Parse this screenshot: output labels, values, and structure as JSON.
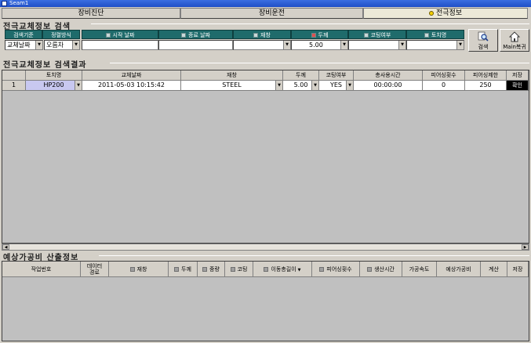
{
  "window": {
    "title": "Seam1"
  },
  "tabs": [
    {
      "label": "장비진단"
    },
    {
      "label": "장비운전"
    },
    {
      "label": "전극정보"
    }
  ],
  "search": {
    "title": "전극교체정보 검색",
    "headers": {
      "criteria": "검색기준",
      "sort": "정렬방식",
      "start_date": "시작 날짜",
      "end_date": "종료 날짜",
      "material": "재창",
      "thickness": "두께",
      "coating": "코팅여부",
      "tip_name": "토치명"
    },
    "values": {
      "criteria": "교체날짜",
      "sort": "오름차",
      "start_date": "",
      "end_date": "",
      "material": "",
      "thickness": "5.00",
      "coating": "",
      "tip_name": ""
    },
    "buttons": {
      "search": "검색",
      "main": "Main복귀"
    }
  },
  "results": {
    "title": "전극교체정보 검색결과",
    "columns": [
      "토치명",
      "교체날짜",
      "재창",
      "두께",
      "코팅여부",
      "총사용시간",
      "피어싱횟수",
      "피어싱제한",
      "저장"
    ],
    "rows": [
      {
        "num": "1",
        "tip": "HP200",
        "date": "2011-05-03 10:15:42",
        "material": "STEEL",
        "thickness": "5.00",
        "coating": "YES",
        "time": "00:00:00",
        "pierce_count": "0",
        "pierce_limit": "250",
        "save": "확인"
      }
    ]
  },
  "cost": {
    "title": "예상가공비 산출정보",
    "columns": {
      "job_no": "작업번호",
      "data_path_1": "데이터",
      "data_path_2": "경로",
      "material": "재창",
      "thickness": "두께",
      "weight": "중량",
      "coating": "코팅",
      "move_length": "이동총길이",
      "pierce_count": "피어싱횟수",
      "prod_time": "생산시간",
      "speed": "가공속도",
      "cost": "예상가공비",
      "calc": "계산",
      "save": "저장"
    }
  },
  "colors": {
    "header_teal": "#1f6b6b",
    "selected_cell": "#c8c8f0",
    "confirm_btn": "#000000"
  }
}
